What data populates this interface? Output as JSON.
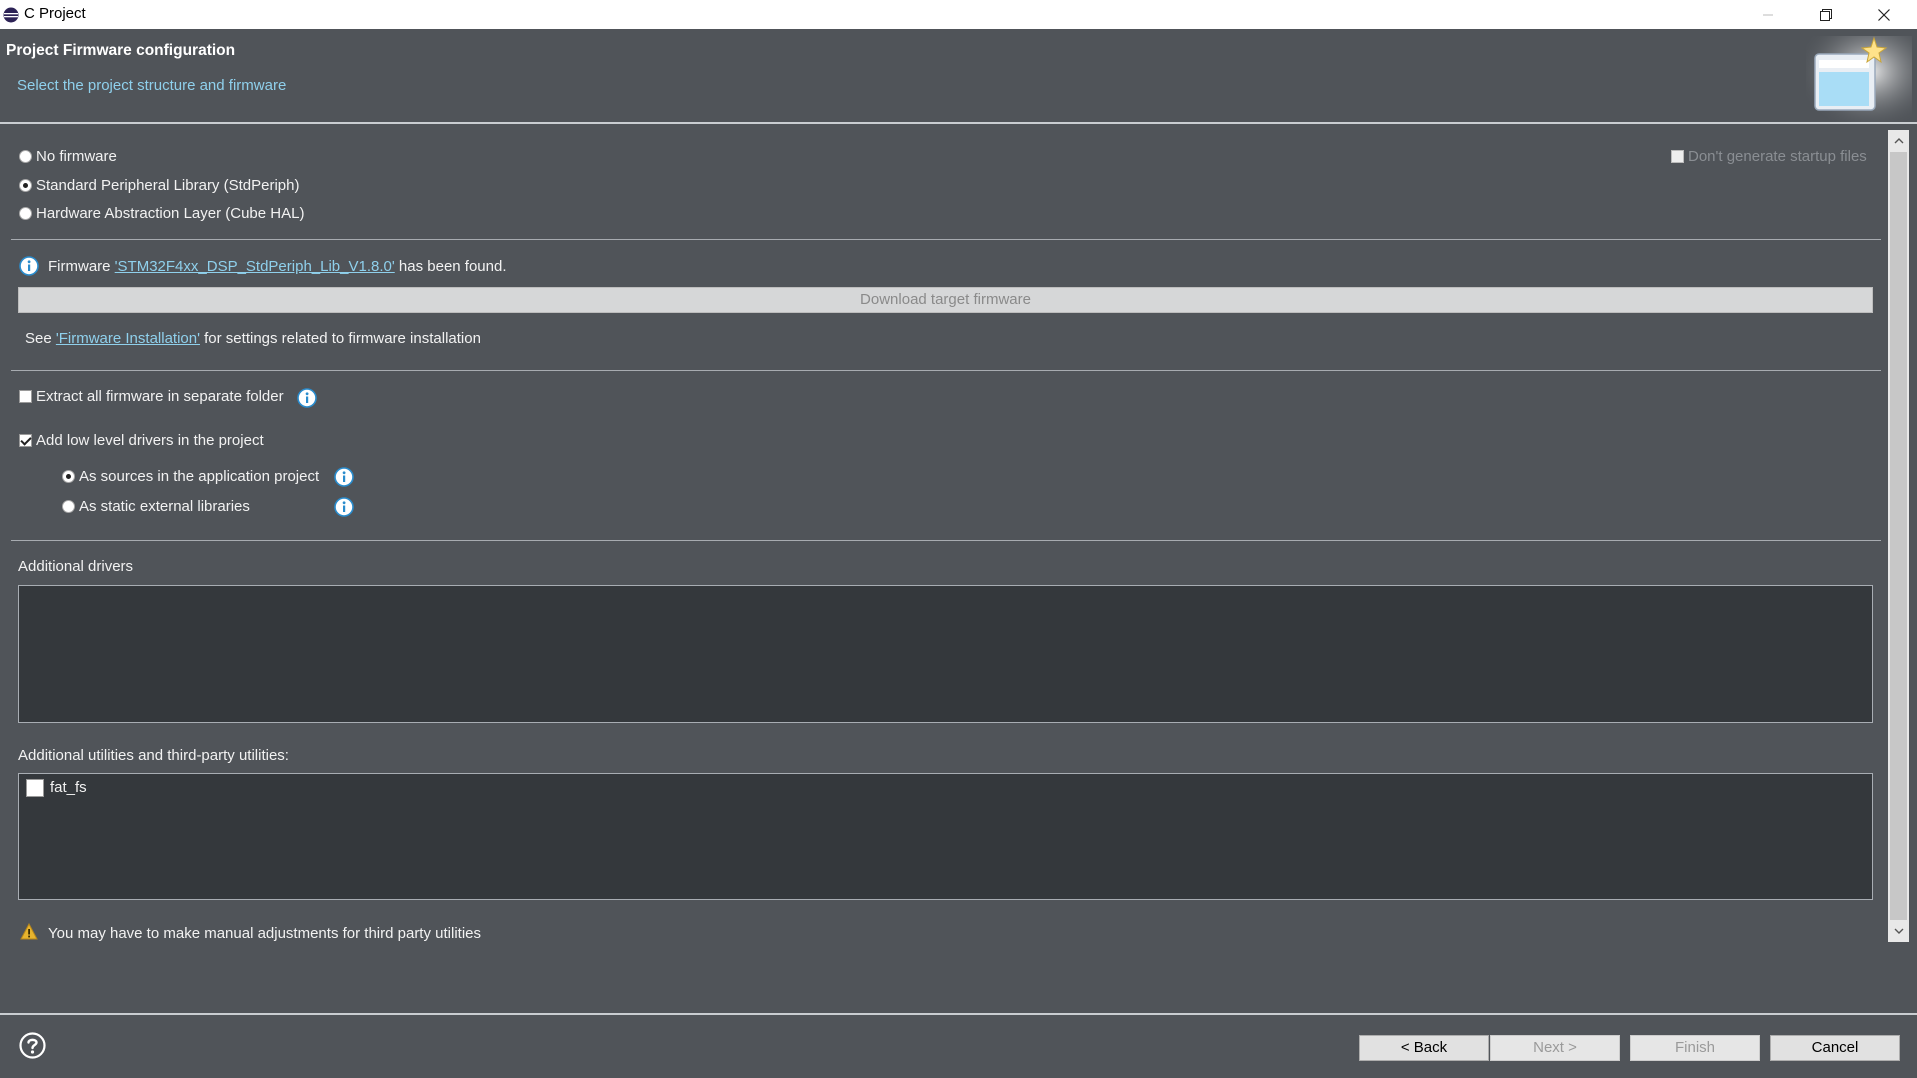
{
  "window": {
    "title": "C Project"
  },
  "header": {
    "title": "Project Firmware configuration",
    "subtitle": "Select the project structure and firmware"
  },
  "firmware_options": [
    {
      "label": "No firmware",
      "selected": false
    },
    {
      "label": "Standard Peripheral Library (StdPeriph)",
      "selected": true
    },
    {
      "label": "Hardware Abstraction Layer (Cube HAL)",
      "selected": false
    }
  ],
  "dont_generate_startup": {
    "label": "Don't generate startup files",
    "checked": false,
    "enabled": false
  },
  "firmware_status": {
    "prefix": "Firmware ",
    "name_link": "'STM32F4xx_DSP_StdPeriph_Lib_V1.8.0'",
    "suffix": " has been found."
  },
  "download_button": "Download target firmware",
  "installation_note": {
    "prefix": "See ",
    "link": "'Firmware Installation'",
    "suffix": " for settings related to firmware installation"
  },
  "extract_firmware": {
    "label": "Extract all firmware in separate folder",
    "checked": false
  },
  "low_level_drivers": {
    "label": "Add low level drivers in the project",
    "checked": true,
    "options": [
      {
        "label": "As sources in the application project",
        "selected": true
      },
      {
        "label": "As static external libraries",
        "selected": false
      }
    ]
  },
  "additional_drivers": {
    "label": "Additional drivers",
    "items": []
  },
  "utilities": {
    "label": "Additional utilities and third-party utilities:",
    "items": [
      {
        "label": "fat_fs",
        "checked": false
      }
    ]
  },
  "warning": "You may have to make manual adjustments for third party utilities",
  "buttons": {
    "back": "< Back",
    "next": "Next >",
    "finish": "Finish",
    "cancel": "Cancel"
  },
  "colors": {
    "background": "#505459",
    "panel": "#34383c",
    "accent_text": "#8fd0ec",
    "info_icon": "#2a8ccd",
    "warning_icon": "#e8b42e"
  },
  "icons": [
    "eclipse-app-icon",
    "minimize-icon",
    "restore-icon",
    "close-icon",
    "wizard-banner-icon",
    "info-icon",
    "warning-icon",
    "help-icon",
    "scroll-up-icon",
    "scroll-down-icon"
  ]
}
